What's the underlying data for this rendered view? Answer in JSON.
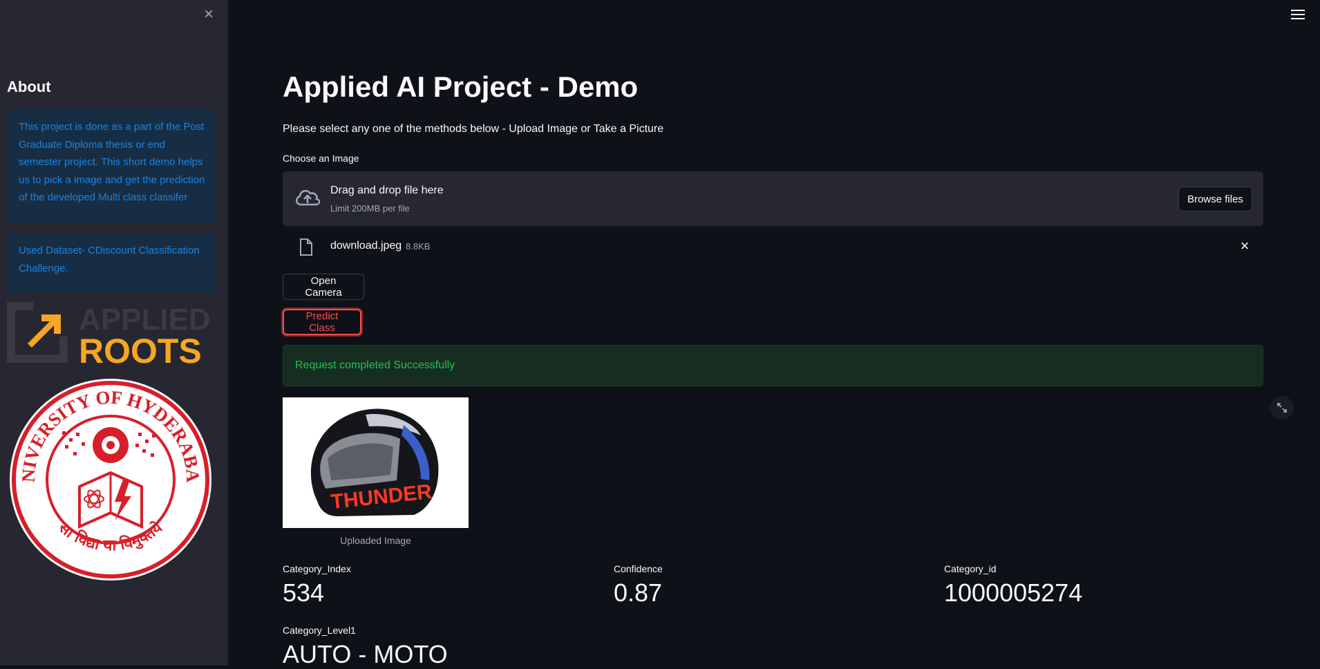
{
  "sidebar": {
    "close_label": "×",
    "about_title": "About",
    "about_text": "This project is done as a part of the Post Graduate Diploma thesis or end semester project. This short demo helps us to pick a image and get the prediction of the developed Multi class classifer",
    "dataset_text": "Used Dataset- CDiscount Classification Challenge.",
    "logo_applied_roots": {
      "line1": "APPLIED",
      "line2": "ROOTS"
    },
    "seal": {
      "top_text": "UNIVERSITY OF HYDERABAD",
      "bottom_text": "सा विद्या या विमुक्तये"
    }
  },
  "main": {
    "title": "Applied AI Project - Demo",
    "instruction": "Please select any one of the methods below - Upload Image or Take a Picture",
    "uploader": {
      "label": "Choose an Image",
      "drop_text": "Drag and drop file here",
      "limit_text": "Limit 200MB per file",
      "browse_label": "Browse files"
    },
    "file": {
      "name": "download.jpeg",
      "size": "8.8KB"
    },
    "open_camera_label": "Open Camera",
    "predict_label": "Predict Class",
    "success_message": "Request completed Successfully",
    "image_caption": "Uploaded Image",
    "image_text": "THUNDER",
    "metrics": {
      "category_index": {
        "label": "Category_Index",
        "value": "534"
      },
      "confidence": {
        "label": "Confidence",
        "value": "0.87"
      },
      "category_id": {
        "label": "Category_id",
        "value": "1000005274"
      },
      "category_level1": {
        "label": "Category_Level1",
        "value": "AUTO - MOTO"
      }
    }
  },
  "colors": {
    "background": "#0e1117",
    "sidebar": "#262730",
    "info_bg": "#172d43",
    "info_text": "#1c83e1",
    "success_bg": "#172d21",
    "success_text": "#21c354",
    "accent_red": "#ff4b4b",
    "roots_orange": "#f5a623",
    "seal_red": "#d71f2a"
  }
}
